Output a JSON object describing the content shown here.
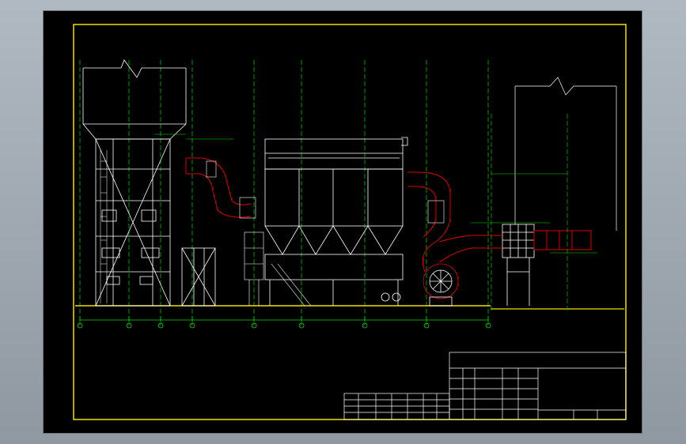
{
  "title_block": {
    "drawing_title": "",
    "rows": [
      {
        "label": "",
        "value": ""
      },
      {
        "label": "",
        "value": ""
      },
      {
        "label": "",
        "value": ""
      },
      {
        "label": "",
        "value": ""
      }
    ]
  },
  "colors": {
    "frame": "#f0e000",
    "structure": "#ffffff",
    "dimension": "#00e000",
    "duct": "#e00000",
    "sheet": "#000000"
  }
}
